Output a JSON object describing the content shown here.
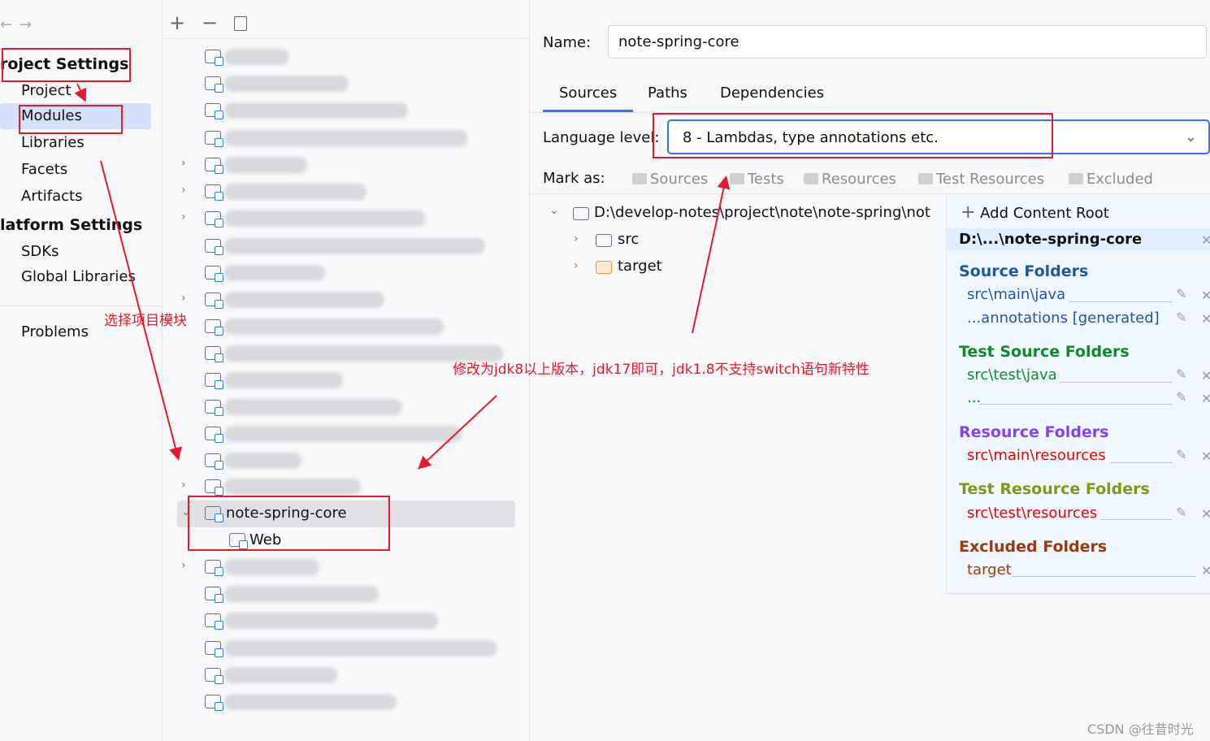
{
  "left": {
    "back_icon": "arrow-left",
    "forward_icon": "arrow-right",
    "project_settings": "roject Settings",
    "items1": [
      "Project",
      "Modules",
      "Libraries",
      "Facets",
      "Artifacts"
    ],
    "platform_settings": "latform Settings",
    "items2": [
      "SDKs",
      "Global Libraries"
    ],
    "problems": "Problems"
  },
  "mid": {
    "toolbar": [
      "plus-icon",
      "minus-icon",
      "copy-icon"
    ],
    "selected_module": "note-spring-core",
    "child": "Web"
  },
  "right": {
    "name_label": "Name:",
    "name_value": "note-spring-core",
    "tabs": [
      "Sources",
      "Paths",
      "Dependencies"
    ],
    "active_tab": "Sources",
    "language_label": "Language level:",
    "language_value": "8 - Lambdas, type annotations etc.",
    "mark_as": "Mark as:",
    "marks": [
      "Sources",
      "Tests",
      "Resources",
      "Test Resources",
      "Excluded"
    ],
    "tree": {
      "root": "D:\\develop-notes\\project\\note\\note-spring\\not",
      "children": [
        "src",
        "target"
      ]
    },
    "add_root": "Add Content Root",
    "root_short": "D:\\...\\note-spring-core",
    "sections": {
      "source": "Source Folders",
      "source_items": [
        "src\\main\\java",
        "...annotations [generated]"
      ],
      "test_source": "Test Source Folders",
      "test_source_items": [
        "src\\test\\java",
        "..."
      ],
      "resource": "Resource Folders",
      "resource_items": [
        "src\\main\\resources"
      ],
      "test_resource": "Test Resource Folders",
      "test_resource_items": [
        "src\\test\\resources"
      ],
      "excluded": "Excluded Folders",
      "excluded_items": [
        "target"
      ]
    }
  },
  "colors": {
    "source": "#1f56a8",
    "test": "#118a2a",
    "resource": "#8a3ff0",
    "test_resource": "#7f9a10",
    "excluded": "#9a3b10",
    "red_path": "#f00000",
    "annotation": "#e8192c",
    "accent": "#3574f0"
  },
  "annotations": {
    "select_module": "选择项目模块",
    "change_level": "修改为jdk8以上版本，jdk17即可，jdk1.8不支持switch语句新特性"
  },
  "watermark": "CSDN @往昔时光"
}
